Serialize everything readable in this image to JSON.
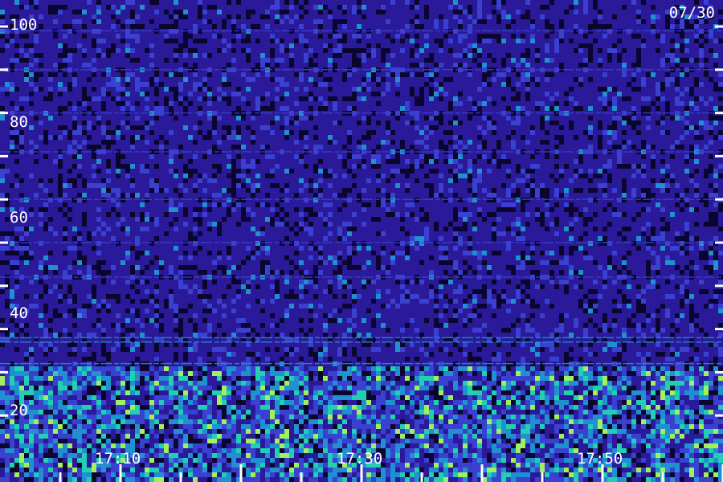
{
  "chart_data": {
    "type": "heatmap",
    "title": "",
    "date_label": "07/30",
    "xlabel": "",
    "ylabel": "",
    "ylim": [
      0,
      100
    ],
    "y_ticks": [
      10,
      20,
      30,
      40,
      50,
      60,
      70,
      80,
      90,
      100
    ],
    "y_tick_labels": [
      {
        "value": 20,
        "label": "20"
      },
      {
        "value": 40,
        "label": "40"
      },
      {
        "value": 60,
        "label": "60"
      },
      {
        "value": 80,
        "label": "80"
      },
      {
        "value": 100,
        "label": "100"
      }
    ],
    "x_minor_tick_minutes": 5,
    "x_tick_labels": [
      {
        "label": "17:10"
      },
      {
        "label": "17:30"
      },
      {
        "label": "17:50"
      }
    ],
    "colormap": [
      "#0a0630",
      "#2a1a9a",
      "#3a40d0",
      "#2090d0",
      "#20d0b0",
      "#a0f060"
    ],
    "background_color": "#1a0f60",
    "tick_color": "#ffffff",
    "label_color": "#ffffff",
    "intense_band": [
      0,
      20
    ],
    "horizontal_lines": [
      99,
      90,
      80,
      71,
      60,
      50,
      42,
      28,
      27,
      22
    ]
  }
}
